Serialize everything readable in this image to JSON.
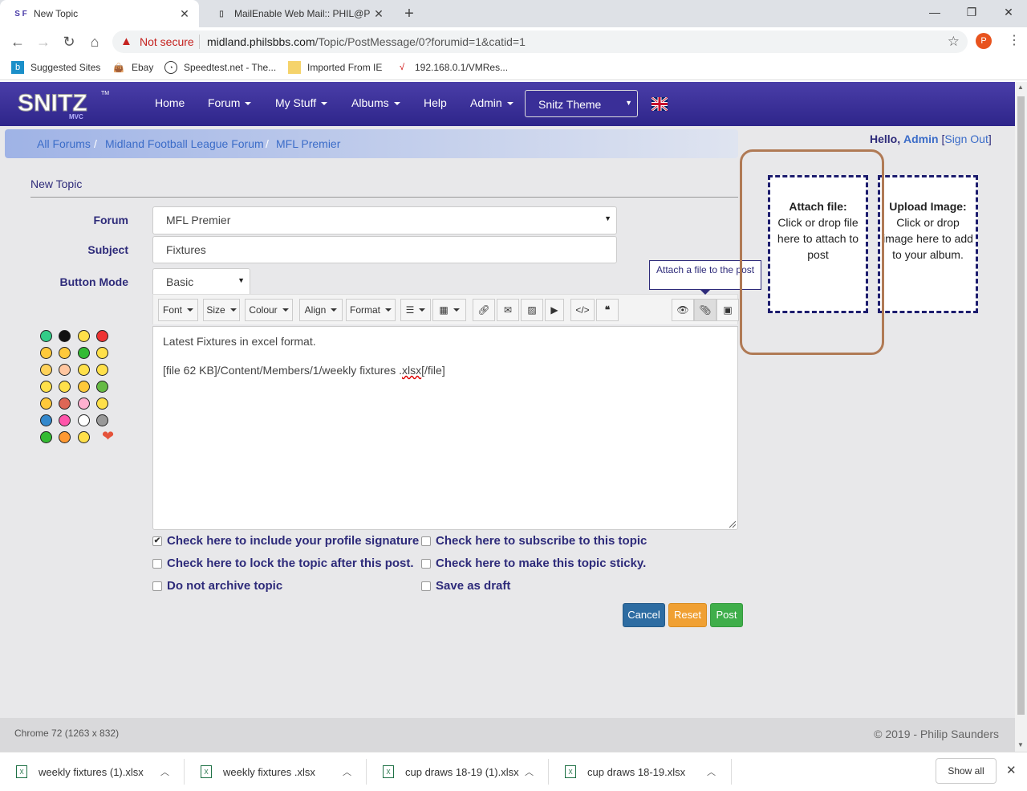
{
  "browser": {
    "tabs": [
      {
        "title": "New Topic",
        "favicon": "S F"
      },
      {
        "title": "MailEnable Web Mail:: PHIL@PHI"
      }
    ],
    "address": {
      "warning": "Not secure",
      "url_host": "midland.philsbbs.com",
      "url_path": "/Topic/PostMessage/0?forumid=1&catid=1"
    },
    "profile_initial": "P",
    "bookmarks": [
      "Suggested Sites",
      "Ebay",
      "Speedtest.net - The...",
      "Imported From IE",
      "192.168.0.1/VMRes..."
    ]
  },
  "site": {
    "logo": "SNITZ",
    "logo_sub": "MVC",
    "logo_tm": "TM",
    "nav": [
      "Home",
      "Forum",
      "My Stuff",
      "Albums",
      "Help",
      "Admin"
    ],
    "theme": "Snitz Theme",
    "breadcrumb": [
      "All Forums",
      "Midland Football League Forum",
      "MFL Premier"
    ],
    "hello": "Hello,",
    "user": "Admin",
    "signout": "Sign Out"
  },
  "form": {
    "heading": "New Topic",
    "forum_label": "Forum",
    "forum_value": "MFL Premier",
    "subject_label": "Subject",
    "subject_value": "Fixtures",
    "mode_label": "Button Mode",
    "mode_value": "Basic",
    "toolbar": {
      "font": "Font",
      "size": "Size",
      "colour": "Colour",
      "align": "Align",
      "format": "Format"
    },
    "tooltip": "Attach a file to the post",
    "body_line1": "Latest Fixtures in excel format.",
    "body_line2_a": "[file 62 KB]/Content/Members/1/weekly fixtures .",
    "body_line2_b": "xlsx",
    "body_line2_c": "[/file]",
    "checkboxes": [
      {
        "label": "Check here to include your profile signature",
        "checked": true
      },
      {
        "label": "Check here to subscribe to this topic",
        "checked": false
      },
      {
        "label": "Check here to lock the topic after this post.",
        "checked": false
      },
      {
        "label": "Check here to make this topic sticky.",
        "checked": false
      },
      {
        "label": "Do not archive topic",
        "checked": false
      },
      {
        "label": "Save as draft",
        "checked": false
      }
    ],
    "buttons": {
      "cancel": "Cancel",
      "reset": "Reset",
      "post": "Post"
    }
  },
  "dropzones": {
    "attach_title": "Attach file:",
    "attach_text": "Click or drop file here to attach to post",
    "upload_title": "Upload Image:",
    "upload_text": "Click or drop image here to add to your album."
  },
  "footer": {
    "left": "Chrome 72 (1263 x 832)",
    "right": "© 2019 - Philip Saunders"
  },
  "downloads": {
    "files": [
      "weekly fixtures (1).xlsx",
      "weekly fixtures .xlsx",
      "cup draws 18-19 (1).xlsx",
      "cup draws 18-19.xlsx"
    ],
    "show_all": "Show all"
  },
  "colors": {
    "navbar": "#3a2f98",
    "cancel": "#2d6ca2",
    "reset": "#f0a033",
    "post": "#3fae4a",
    "highlight_circle": "#b07a55"
  }
}
